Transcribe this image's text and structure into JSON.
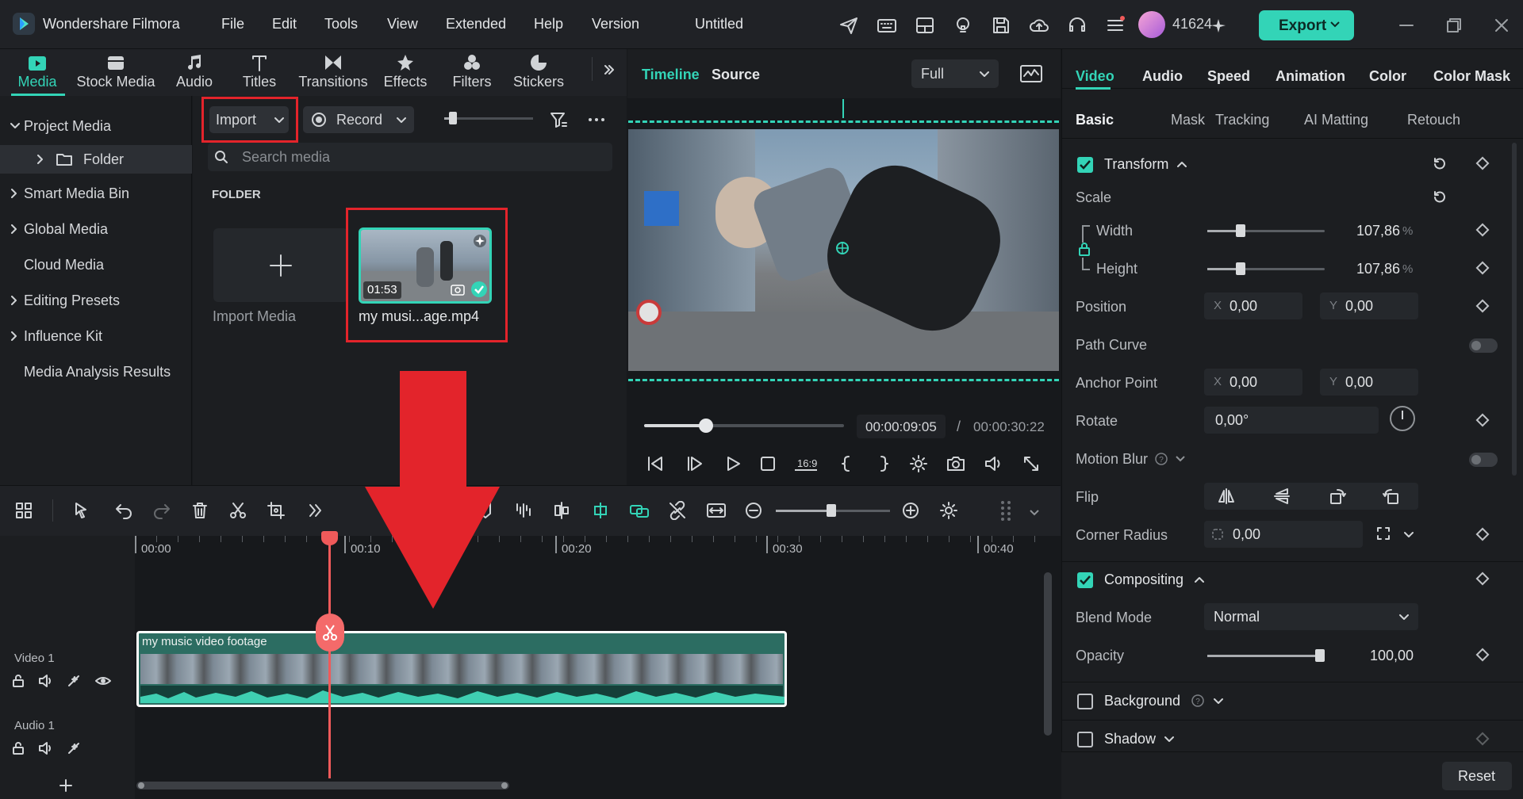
{
  "app": {
    "name": "Wondershare Filmora",
    "project_title": "Untitled",
    "credits": "41624"
  },
  "menu": [
    "File",
    "Edit",
    "Tools",
    "View",
    "Extended",
    "Help",
    "Version"
  ],
  "export_label": "Export",
  "media_tabs": [
    "Media",
    "Stock Media",
    "Audio",
    "Titles",
    "Transitions",
    "Effects",
    "Filters",
    "Stickers"
  ],
  "sidebar": {
    "project_media": "Project Media",
    "folder": "Folder",
    "items": [
      "Smart Media Bin",
      "Global Media",
      "Cloud Media",
      "Editing Presets",
      "Influence Kit",
      "Media Analysis Results"
    ]
  },
  "media": {
    "import_label": "Import",
    "record_label": "Record",
    "search_placeholder": "Search media",
    "section": "FOLDER",
    "import_tile_label": "Import Media",
    "clip_name": "my musi...age.mp4",
    "clip_duration": "01:53"
  },
  "preview": {
    "tab_timeline": "Timeline",
    "tab_source": "Source",
    "quality": "Full",
    "current_time": "00:00:09:05",
    "separator": "/",
    "total_time": "00:00:30:22",
    "aspect": "16:9",
    "progress_fraction": 0.31
  },
  "props": {
    "tabs": [
      "Video",
      "Audio",
      "Speed",
      "Animation",
      "Color",
      "Color Mask"
    ],
    "subtabs": [
      "Basic",
      "Mask",
      "Tracking",
      "AI Matting",
      "Retouch"
    ],
    "transform": "Transform",
    "scale": "Scale",
    "width_label": "Width",
    "width_value": "107,86",
    "height_label": "Height",
    "height_value": "107,86",
    "percent": "%",
    "position": "Position",
    "pos_x": "0,00",
    "pos_y": "0,00",
    "path_curve": "Path Curve",
    "anchor_point": "Anchor Point",
    "anchor_x": "0,00",
    "anchor_y": "0,00",
    "rotate": "Rotate",
    "rotate_value": "0,00°",
    "motion_blur": "Motion Blur",
    "flip": "Flip",
    "corner_radius": "Corner Radius",
    "corner_value": "0,00",
    "compositing": "Compositing",
    "blend_mode": "Blend Mode",
    "blend_value": "Normal",
    "opacity": "Opacity",
    "opacity_value": "100,00",
    "background": "Background",
    "shadow": "Shadow",
    "reset": "Reset",
    "x_prefix": "X",
    "y_prefix": "Y"
  },
  "timeline": {
    "ruler": [
      "00:00",
      "00:10",
      "00:20",
      "00:30",
      "00:40"
    ],
    "video_track": "Video 1",
    "audio_track": "Audio 1",
    "clip_title": "my music video footage"
  },
  "colors": {
    "accent": "#33d4b7",
    "highlight": "#e3242b",
    "playhead": "#f05a5a"
  }
}
